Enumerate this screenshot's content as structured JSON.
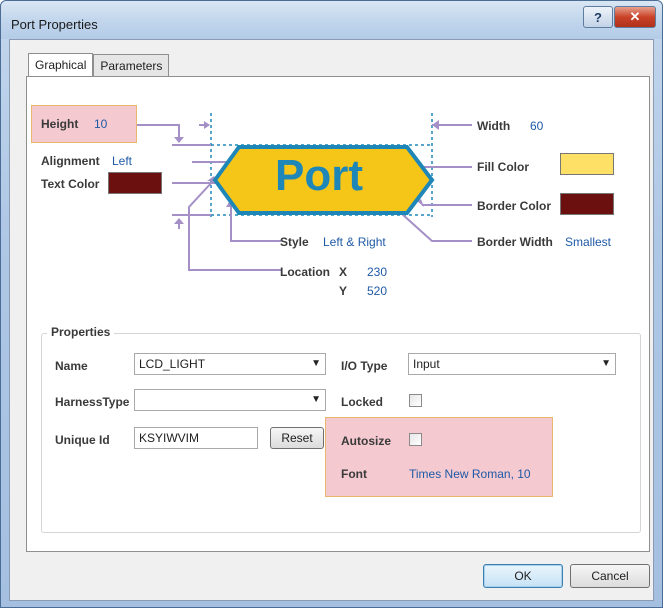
{
  "window": {
    "title": "Port Properties"
  },
  "titlebar": {
    "help_glyph": "?",
    "close_glyph": "✕"
  },
  "tabs": [
    {
      "label": "Graphical",
      "active": true
    },
    {
      "label": "Parameters",
      "active": false
    }
  ],
  "graphical": {
    "height_label": "Height",
    "height_value": "10",
    "alignment_label": "Alignment",
    "alignment_value": "Left",
    "text_color_label": "Text Color",
    "text_color": "#6b0f0f",
    "width_label": "Width",
    "width_value": "60",
    "fill_color_label": "Fill Color",
    "fill_color": "#ffe066",
    "border_color_label": "Border Color",
    "border_color": "#6b0f0f",
    "border_width_label": "Border Width",
    "border_width_value": "Smallest",
    "style_label": "Style",
    "style_value": "Left & Right",
    "location_label": "Location",
    "x_label": "X",
    "x_value": "230",
    "y_label": "Y",
    "y_value": "520",
    "port_text": "Port",
    "port_fill": "#f5c518",
    "port_border": "#1f87b8",
    "port_text_color": "#1f87b8",
    "annotation_color": "#a58fc7"
  },
  "properties": {
    "group_title": "Properties",
    "name_label": "Name",
    "name_value": "LCD_LIGHT",
    "harness_label": "HarnessType",
    "harness_value": "",
    "unique_id_label": "Unique Id",
    "unique_id_value": "KSYIWVIM",
    "reset_label": "Reset",
    "io_type_label": "I/O Type",
    "io_type_value": "Input",
    "locked_label": "Locked",
    "locked_checked": false,
    "autosize_label": "Autosize",
    "autosize_checked": false,
    "font_label": "Font",
    "font_value": "Times New Roman, 10"
  },
  "footer": {
    "ok_label": "OK",
    "cancel_label": "Cancel"
  },
  "icons": {
    "dropdown": "chevron-down-icon"
  }
}
